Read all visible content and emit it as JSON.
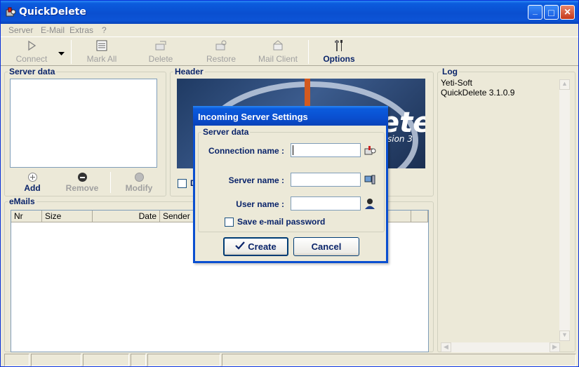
{
  "app": {
    "title": "QuickDelete"
  },
  "titlebar": {
    "minimize": "_",
    "maximize": "□",
    "close": "×"
  },
  "menu": [
    "Server",
    "E-Mail",
    "Extras",
    "?"
  ],
  "toolbar": {
    "connect": "Connect",
    "mark_all": "Mark All",
    "delete": "Delete",
    "restore": "Restore",
    "mail_client": "Mail Client",
    "options": "Options"
  },
  "server_panel": {
    "title": "Server data",
    "add": "Add",
    "remove": "Remove",
    "modify": "Modify"
  },
  "header_panel": {
    "title": "Header",
    "banner_text": "ete",
    "banner_sub": "sion 3",
    "checkbox_label": "D"
  },
  "log_panel": {
    "title": "Log",
    "lines": [
      "Yeti-Soft",
      "QuickDelete 3.1.0.9"
    ]
  },
  "emails_panel": {
    "title": "eMails",
    "columns": [
      "Nr",
      "Size",
      "Date",
      "Sender"
    ]
  },
  "dialog": {
    "title": "Incoming Server Settings",
    "group": "Server data",
    "connection_label": "Connection name :",
    "connection_value": "",
    "server_label": "Server name :",
    "server_value": "",
    "user_label": "User name :",
    "user_value": "",
    "save_password_label": "Save e-mail password",
    "save_password_checked": false,
    "create": "Create",
    "cancel": "Cancel"
  },
  "colors": {
    "accent": "#0A246A",
    "titlebar": "#0A4FD0",
    "disabled": "#A0A0A0"
  }
}
